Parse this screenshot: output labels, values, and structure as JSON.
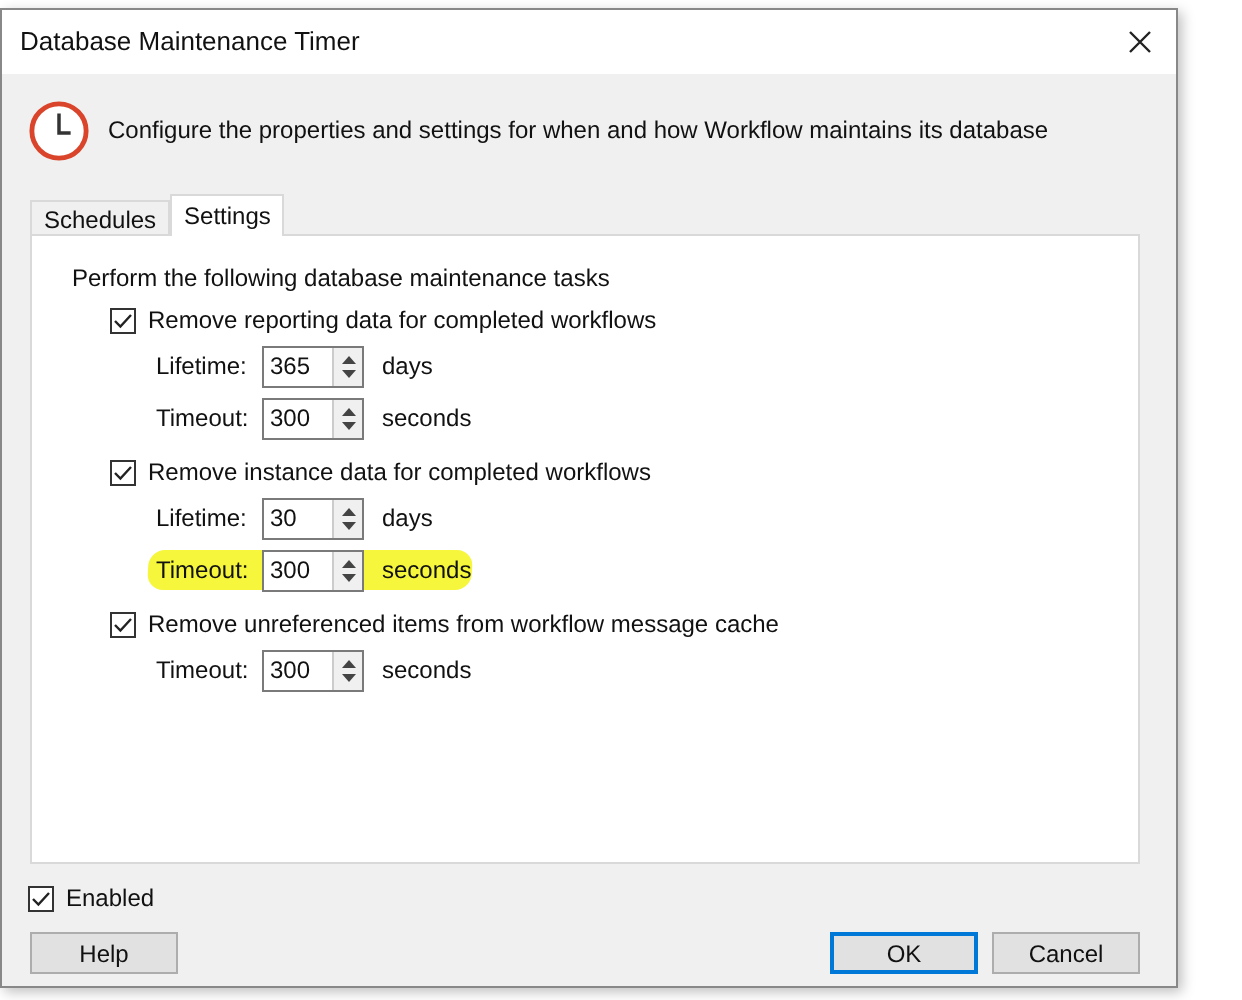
{
  "window": {
    "title": "Database Maintenance Timer"
  },
  "description": "Configure the properties and settings for when and how Workflow maintains its database",
  "tabs": [
    {
      "label": "Schedules",
      "selected": false
    },
    {
      "label": "Settings",
      "selected": true
    }
  ],
  "section_heading": "Perform the following database maintenance tasks",
  "tasks": [
    {
      "label": "Remove reporting data for completed workflows",
      "checked": true,
      "fields": [
        {
          "label": "Lifetime:",
          "value": "365",
          "unit": "days",
          "highlighted": false
        },
        {
          "label": "Timeout:",
          "value": "300",
          "unit": "seconds",
          "highlighted": false
        }
      ]
    },
    {
      "label": "Remove instance data for completed workflows",
      "checked": true,
      "fields": [
        {
          "label": "Lifetime:",
          "value": "30",
          "unit": "days",
          "highlighted": false
        },
        {
          "label": "Timeout:",
          "value": "300",
          "unit": "seconds",
          "highlighted": true
        }
      ]
    },
    {
      "label": "Remove unreferenced items from workflow message cache",
      "checked": true,
      "fields": [
        {
          "label": "Timeout:",
          "value": "300",
          "unit": "seconds",
          "highlighted": false
        }
      ]
    }
  ],
  "enabled": {
    "label": "Enabled",
    "checked": true
  },
  "buttons": [
    {
      "label": "Help",
      "kind": "normal"
    },
    {
      "label": "OK",
      "kind": "default"
    },
    {
      "label": "Cancel",
      "kind": "normal"
    }
  ]
}
